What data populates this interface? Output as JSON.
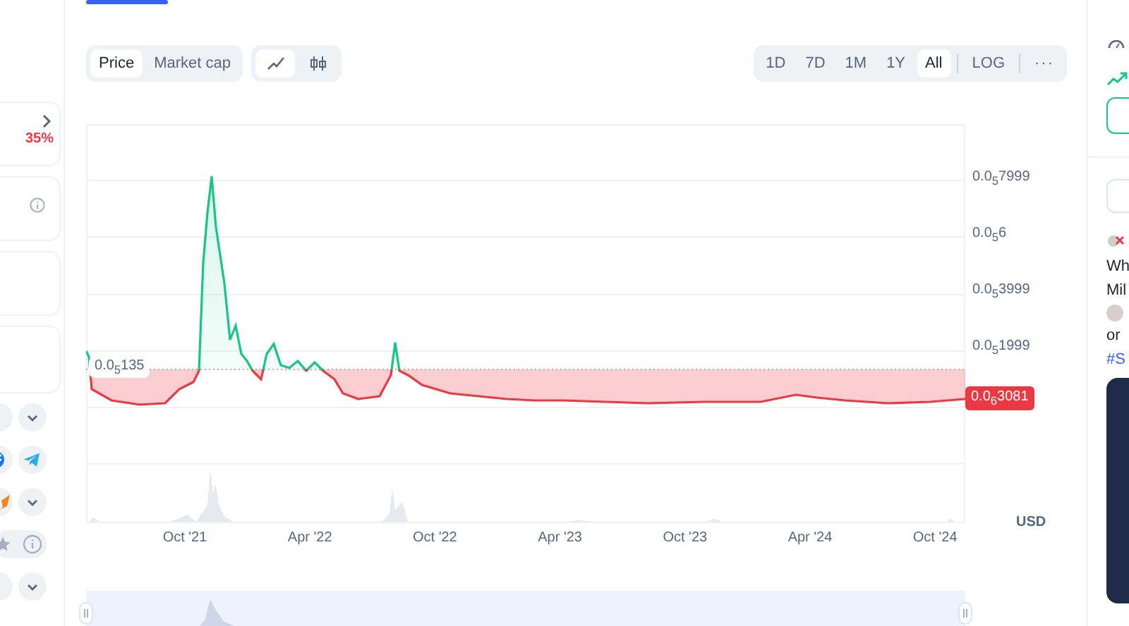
{
  "left_panel": {
    "change": "35%"
  },
  "chart_controls": {
    "type_tabs": [
      {
        "label": "Price",
        "selected": true
      },
      {
        "label": "Market cap",
        "selected": false
      }
    ],
    "view_tabs": [
      {
        "kind": "line",
        "selected": true
      },
      {
        "kind": "candles",
        "selected": false
      }
    ],
    "ranges": [
      {
        "label": "1D",
        "selected": false
      },
      {
        "label": "7D",
        "selected": false
      },
      {
        "label": "1M",
        "selected": false
      },
      {
        "label": "1Y",
        "selected": false
      },
      {
        "label": "All",
        "selected": true
      }
    ],
    "log": {
      "label": "LOG",
      "selected": false
    },
    "more": "···"
  },
  "chart": {
    "y_labels": [
      "0.0$_{5}$7999",
      "0.0$_{5}$6",
      "0.0$_{5}$3999",
      "0.0$_{5}$1999"
    ],
    "x_labels": [
      "Oct '21",
      "Apr '22",
      "Oct '22",
      "Apr '23",
      "Oct '23",
      "Apr '24",
      "Oct '24"
    ],
    "baseline_label": "0.0$_{5}$135",
    "current_price": "0.0$_{6}$3081",
    "currency": "USD"
  },
  "right_panel": {
    "lines": [
      "Wh",
      "Mil"
    ],
    "line_after_avatar": "or",
    "hashtag": "#S"
  }
}
